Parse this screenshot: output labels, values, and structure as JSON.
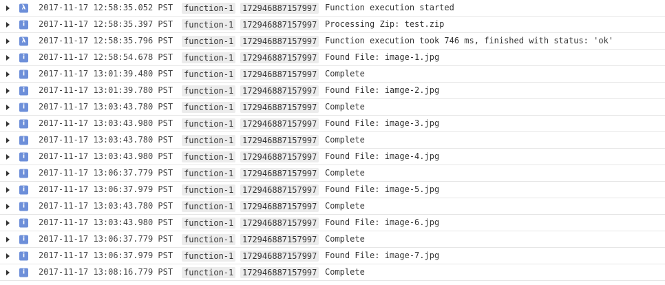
{
  "icons": {
    "expander": "triangle-right-icon",
    "info": "info-icon",
    "lambda": "lambda-icon"
  },
  "colors": {
    "severity_badge": "#6d8fd9",
    "chip_background": "#ececec",
    "row_divider": "#e6e6e6"
  },
  "rows": [
    {
      "severity": "lambda",
      "badge": "λ",
      "timestamp": "2017-11-17 12:58:35.052 PST",
      "function": "function-1",
      "execution_id": "172946887157997",
      "message": "Function execution started"
    },
    {
      "severity": "info",
      "badge": "i",
      "timestamp": "2017-11-17 12:58:35.397 PST",
      "function": "function-1",
      "execution_id": "172946887157997",
      "message": "Processing Zip: test.zip"
    },
    {
      "severity": "lambda",
      "badge": "λ",
      "timestamp": "2017-11-17 12:58:35.796 PST",
      "function": "function-1",
      "execution_id": "172946887157997",
      "message": "Function execution took 746 ms, finished with status: 'ok'"
    },
    {
      "severity": "info",
      "badge": "i",
      "timestamp": "2017-11-17 12:58:54.678 PST",
      "function": "function-1",
      "execution_id": "172946887157997",
      "message": "Found File: image-1.jpg"
    },
    {
      "severity": "info",
      "badge": "i",
      "timestamp": "2017-11-17 13:01:39.480 PST",
      "function": "function-1",
      "execution_id": "172946887157997",
      "message": "Complete"
    },
    {
      "severity": "info",
      "badge": "i",
      "timestamp": "2017-11-17 13:01:39.780 PST",
      "function": "function-1",
      "execution_id": "172946887157997",
      "message": "Found File: iamge-2.jpg"
    },
    {
      "severity": "info",
      "badge": "i",
      "timestamp": "2017-11-17 13:03:43.780 PST",
      "function": "function-1",
      "execution_id": "172946887157997",
      "message": "Complete"
    },
    {
      "severity": "info",
      "badge": "i",
      "timestamp": "2017-11-17 13:03:43.980 PST",
      "function": "function-1",
      "execution_id": "172946887157997",
      "message": "Found File: image-3.jpg"
    },
    {
      "severity": "info",
      "badge": "i",
      "timestamp": "2017-11-17 13:03:43.780 PST",
      "function": "function-1",
      "execution_id": "172946887157997",
      "message": "Complete"
    },
    {
      "severity": "info",
      "badge": "i",
      "timestamp": "2017-11-17 13:03:43.980 PST",
      "function": "function-1",
      "execution_id": "172946887157997",
      "message": "Found File: image-4.jpg"
    },
    {
      "severity": "info",
      "badge": "i",
      "timestamp": "2017-11-17 13:06:37.779 PST",
      "function": "function-1",
      "execution_id": "172946887157997",
      "message": "Complete"
    },
    {
      "severity": "info",
      "badge": "i",
      "timestamp": "2017-11-17 13:06:37.979 PST",
      "function": "function-1",
      "execution_id": "172946887157997",
      "message": "Found File: image-5.jpg"
    },
    {
      "severity": "info",
      "badge": "i",
      "timestamp": "2017-11-17 13:03:43.780 PST",
      "function": "function-1",
      "execution_id": "172946887157997",
      "message": "Complete"
    },
    {
      "severity": "info",
      "badge": "i",
      "timestamp": "2017-11-17 13:03:43.980 PST",
      "function": "function-1",
      "execution_id": "172946887157997",
      "message": "Found File: image-6.jpg"
    },
    {
      "severity": "info",
      "badge": "i",
      "timestamp": "2017-11-17 13:06:37.779 PST",
      "function": "function-1",
      "execution_id": "172946887157997",
      "message": "Complete"
    },
    {
      "severity": "info",
      "badge": "i",
      "timestamp": "2017-11-17 13:06:37.979 PST",
      "function": "function-1",
      "execution_id": "172946887157997",
      "message": "Found File: image-7.jpg"
    },
    {
      "severity": "info",
      "badge": "i",
      "timestamp": "2017-11-17 13:08:16.779 PST",
      "function": "function-1",
      "execution_id": "172946887157997",
      "message": "Complete"
    }
  ]
}
